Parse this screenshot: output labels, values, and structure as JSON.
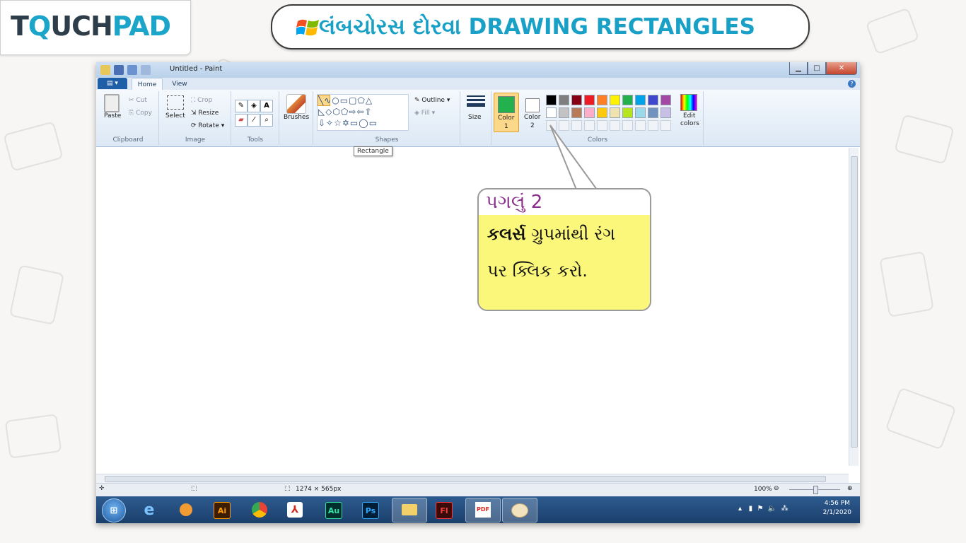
{
  "header": {
    "logo_part1": "T",
    "logo_part2": "Q",
    "logo_part3": "UCH",
    "logo_part4": "PAD",
    "title": "લંબચોરસ દોરવા DRAWING RECTANGLES"
  },
  "paint": {
    "window_title": "Untitled - Paint",
    "tabs": {
      "home": "Home",
      "view": "View"
    },
    "clipboard": {
      "paste": "Paste",
      "cut": "Cut",
      "copy": "Copy",
      "group": "Clipboard"
    },
    "image": {
      "select": "Select",
      "crop": "Crop",
      "resize": "Resize",
      "rotate": "Rotate ▾",
      "group": "Image"
    },
    "tools": {
      "group": "Tools"
    },
    "brushes": {
      "label": "Brushes"
    },
    "shapes": {
      "outline": "Outline ▾",
      "fill": "Fill ▾",
      "group": "Shapes"
    },
    "size": {
      "label": "Size"
    },
    "color1": {
      "label": "Color",
      "sub": "1"
    },
    "color2": {
      "label": "Color",
      "sub": "2"
    },
    "colors_group": "Colors",
    "edit_colors": {
      "line1": "Edit",
      "line2": "colors"
    },
    "tooltip": "Rectangle",
    "status": {
      "size": "1274 × 565px",
      "zoom": "100%"
    },
    "clock": {
      "time": "4:56 PM",
      "date": "2/1/2020"
    },
    "palette_row1": [
      "#000000",
      "#7f7f7f",
      "#880015",
      "#ed1c24",
      "#ff7f27",
      "#fff200",
      "#22b14c",
      "#00a2e8",
      "#3f48cc",
      "#a349a4"
    ],
    "palette_row2": [
      "#ffffff",
      "#c3c3c3",
      "#b97a57",
      "#ffaec9",
      "#ffc90e",
      "#efe4b0",
      "#b5e61d",
      "#99d9ea",
      "#7092be",
      "#c8bfe7"
    ],
    "color1_value": "#22b14c",
    "color2_value": "#ffffff"
  },
  "callout": {
    "step": "પગલું 2",
    "line1_bold": "કલર્સ",
    "line1_rest": " ગ્રુપમાંથી રંગ",
    "line2": "પર ક્લિક કરો."
  },
  "taskbar": {
    "ai": "Ai",
    "au": "Au",
    "ps": "Ps",
    "fl": "Fl",
    "pdf": "PDF"
  }
}
